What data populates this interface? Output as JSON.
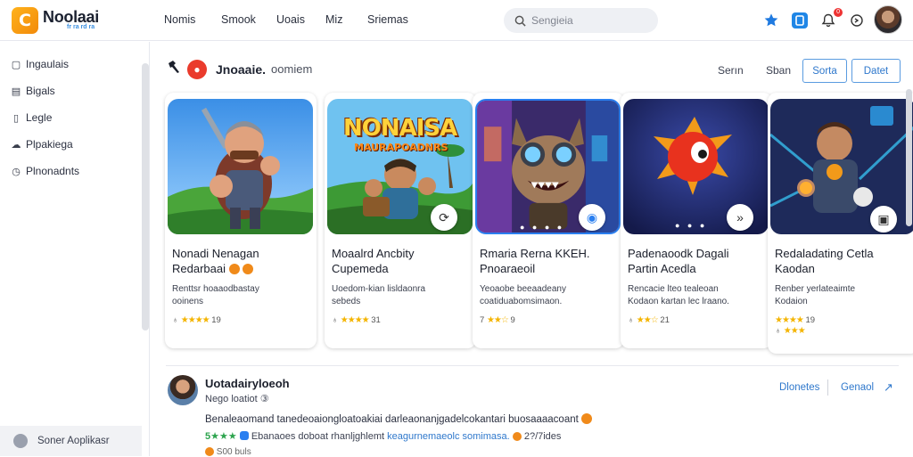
{
  "app": {
    "logo_letter": "C",
    "name": "Noolaai",
    "subtitle": "fr ra rd ra"
  },
  "topnav": [
    "Nomis",
    "Smook",
    "Uoais",
    "Miz",
    "Sriemas"
  ],
  "search": {
    "placeholder": "Sengieia"
  },
  "topbar_icons": {
    "star": "star-icon",
    "app": "app-icon",
    "bell": "bell-icon",
    "bell_badge": "0",
    "settings": "settings-icon"
  },
  "sidebar": {
    "items": [
      {
        "label": "Ingaulais",
        "icon": "grid-icon"
      },
      {
        "label": "Bigals",
        "icon": "book-icon"
      },
      {
        "label": "Legle",
        "icon": "page-icon"
      },
      {
        "label": "Plpakiega",
        "icon": "cloud-icon"
      },
      {
        "label": "Plnonadnts",
        "icon": "clock-icon"
      }
    ],
    "footer": "Soner Aoplikasr"
  },
  "section": {
    "title": "Jnoaaie.",
    "subtitle": "oomiem",
    "link1": "Serın",
    "link2": "Sban",
    "btn1": "Sorta",
    "btn2": "Datet"
  },
  "cards": [
    {
      "title1": "Nonadi Nenagan",
      "title2": "Redarbaai",
      "desc1": "Renttsr hoaaodbastay",
      "desc2": "ooinens",
      "rating_prefix": "♁",
      "rating_stars": "★★★★",
      "rating_value": "19"
    },
    {
      "art_title": "NONAISA",
      "art_sub": "MAURAPOADNRS",
      "title1": "Moaalrd Ancbity",
      "title2": "Cupemeda",
      "desc1": "Uoedom-kian lisldaonra",
      "desc2": "sebeds",
      "rating_prefix": "♁",
      "rating_stars": "★★★★",
      "rating_value": "31"
    },
    {
      "title1": "Rmaria Rerna KKEH.",
      "title2": "Pnoaraeoil",
      "desc1": "Yeoaobe beeaadeany",
      "desc2": "coatiduabomsimaon.",
      "rating_prefix": "7",
      "rating_stars": "★★☆",
      "rating_value": "9"
    },
    {
      "title1": "Padenaoodk Dagali",
      "title2": "Partin Acedla",
      "desc1": "Rencacie lteo tealeoan",
      "desc2": "Kodaon kartan lec lraano.",
      "rating_prefix": "♁",
      "rating_stars": "★★☆",
      "rating_value": "21"
    },
    {
      "title1": "Redaladating Cetla",
      "title2": "Kaodan",
      "desc1": "Renber yerlateaimte",
      "desc2": "Kodaion",
      "rating_prefix": "",
      "rating_stars": "★★★★",
      "rating_value": "19",
      "rating2_prefix": "♁",
      "rating2_stars": "★★★",
      "rating2_value": ""
    }
  ],
  "review": {
    "name": "Uotadairyloeoh",
    "sub": "Nego loatiot ③",
    "link1": "Dlonetes",
    "link2": "Genaol",
    "text1": "Benaleaomand tanedeoaiongloatoakiai darleaonanjgadelcokantari buosaaaacoant",
    "text2_stars": "5★★★",
    "text2": "Ebanaoes doboat rhanljghlemt",
    "text2_link": "keagurnemaeolc somimasa.",
    "text2_end": "2?/7ides",
    "text3": "S00 buls"
  }
}
